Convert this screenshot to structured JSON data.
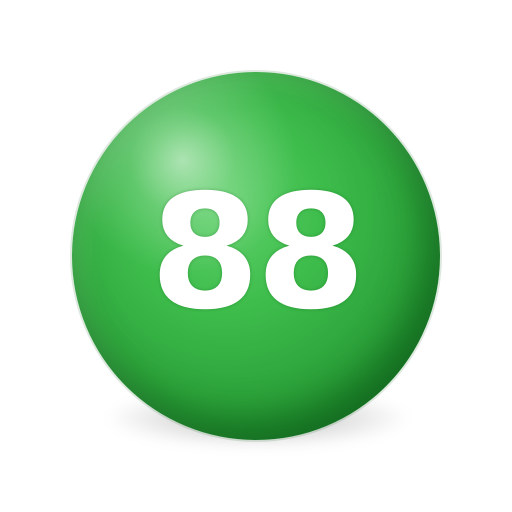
{
  "ball": {
    "number": "88",
    "color": "#2ea63c",
    "text_color": "#ffffff"
  }
}
